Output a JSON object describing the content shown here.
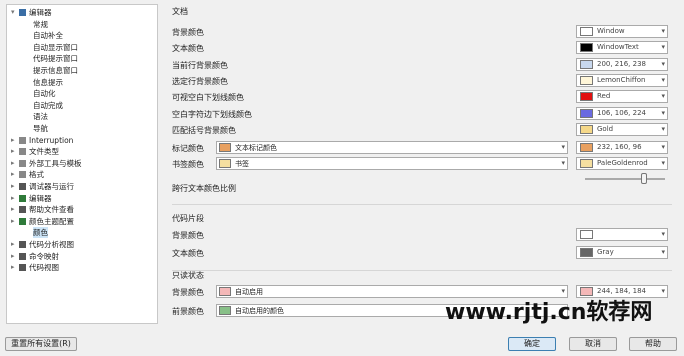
{
  "tree": {
    "items": [
      {
        "label": "编辑器",
        "indent": 0,
        "twisty": "▾",
        "icon": "pencil-icon",
        "color": "#3a6ea5",
        "selected": false
      },
      {
        "label": "常规",
        "indent": 1,
        "twisty": "",
        "icon": "",
        "color": "",
        "selected": false
      },
      {
        "label": "自动补全",
        "indent": 1,
        "twisty": "",
        "icon": "",
        "color": "",
        "selected": false
      },
      {
        "label": "自动显示窗口",
        "indent": 1,
        "twisty": "",
        "icon": "",
        "color": "",
        "selected": false
      },
      {
        "label": "代码提示窗口",
        "indent": 1,
        "twisty": "",
        "icon": "",
        "color": "",
        "selected": false
      },
      {
        "label": "提示信息窗口",
        "indent": 1,
        "twisty": "",
        "icon": "",
        "color": "",
        "selected": false
      },
      {
        "label": "信息提示",
        "indent": 1,
        "twisty": "",
        "icon": "",
        "color": "",
        "selected": false
      },
      {
        "label": "自动化",
        "indent": 1,
        "twisty": "",
        "icon": "",
        "color": "",
        "selected": false
      },
      {
        "label": "自动完成",
        "indent": 1,
        "twisty": "",
        "icon": "",
        "color": "",
        "selected": false
      },
      {
        "label": "语法",
        "indent": 1,
        "twisty": "",
        "icon": "",
        "color": "",
        "selected": false
      },
      {
        "label": "导航",
        "indent": 1,
        "twisty": "",
        "icon": "",
        "color": "",
        "selected": false
      },
      {
        "label": "Interruption",
        "indent": 0,
        "twisty": "▸",
        "icon": "interrupt-icon",
        "color": "#888888",
        "selected": false
      },
      {
        "label": "文件类型",
        "indent": 0,
        "twisty": "▸",
        "icon": "file-type-icon",
        "color": "#888888",
        "selected": false
      },
      {
        "label": "外部工具与模板",
        "indent": 0,
        "twisty": "▸",
        "icon": "tools-icon",
        "color": "#888888",
        "selected": false
      },
      {
        "label": "格式",
        "indent": 0,
        "twisty": "▸",
        "icon": "format-icon",
        "color": "#888888",
        "selected": false
      },
      {
        "label": "调试器与运行",
        "indent": 0,
        "twisty": "▸",
        "icon": "debugger-icon",
        "color": "#555555",
        "selected": false
      },
      {
        "label": "编辑器",
        "indent": 0,
        "twisty": "▸",
        "icon": "editor-icon",
        "color": "#2f7a3a",
        "selected": false
      },
      {
        "label": "帮助文件查看",
        "indent": 0,
        "twisty": "▸",
        "icon": "help-icon",
        "color": "#555555",
        "selected": false
      },
      {
        "label": "颜色主题配置",
        "indent": 0,
        "twisty": "▸",
        "icon": "theme-icon",
        "color": "#2f7a3a",
        "selected": false
      },
      {
        "label": "颜色",
        "indent": 1,
        "twisty": "",
        "icon": "",
        "color": "",
        "selected": true
      },
      {
        "label": "代码分析视图",
        "indent": 0,
        "twisty": "▸",
        "icon": "analysis-icon",
        "color": "#555555",
        "selected": false
      },
      {
        "label": "命令映射",
        "indent": 0,
        "twisty": "▸",
        "icon": "command-icon",
        "color": "#555555",
        "selected": false
      },
      {
        "label": "代码视图",
        "indent": 0,
        "twisty": "▸",
        "icon": "codeview-icon",
        "color": "#555555",
        "selected": false
      }
    ]
  },
  "sections": {
    "tabs": "文档",
    "other": "代码片段",
    "readonly": "只读状态"
  },
  "rows": [
    {
      "label": "背景颜色",
      "swatch": "#ffffff",
      "text": "Window"
    },
    {
      "label": "文本颜色",
      "swatch": "#000000",
      "text": "WindowText"
    },
    {
      "label": "当前行背景颜色",
      "swatch": "#c8d8ee",
      "text": "200, 216, 238"
    },
    {
      "label": "选定行背景颜色",
      "swatch": "#fff6d8",
      "text": "LemonChiffon"
    },
    {
      "label": "可视空白下划线颜色",
      "swatch": "#e01010",
      "text": "Red"
    },
    {
      "label": "空白字符边下划线颜色",
      "swatch": "#6a6ae0",
      "text": "106, 106, 224"
    },
    {
      "label": "匹配括号背景颜色",
      "swatch": "#f5d889",
      "text": "Gold"
    }
  ],
  "wide_rows": [
    {
      "label": "标记颜色",
      "wide_swatch": "#e8a060",
      "wide_text": "文本标记颜色",
      "swatch": "#e8a060",
      "text": "232, 160, 96"
    },
    {
      "label": "书签颜色",
      "wide_swatch": "#f5dfa0",
      "wide_text": "书签",
      "swatch": "#f5dfa0",
      "text": "PaleGoldenrod"
    }
  ],
  "slider_label": "跨行文本颜色比例",
  "other_rows": [
    {
      "label": "背景颜色",
      "swatch": "#ffffff",
      "text": ""
    },
    {
      "label": "文本颜色",
      "swatch": "#666666",
      "text": "Gray"
    }
  ],
  "readonly_rows": [
    {
      "label": "背景颜色",
      "wide_swatch": "#f4b8b8",
      "wide_text": "自动启用",
      "swatch": "#f4b8b8",
      "text": "244, 184, 184"
    },
    {
      "label": "前景颜色",
      "wide_swatch": "#88c088",
      "wide_text": "自动启用的颜色",
      "swatch": "",
      "text": ""
    }
  ],
  "buttons": {
    "restore": "重置所有设置(R)",
    "ok": "确定",
    "cancel": "取消",
    "help": "帮助"
  },
  "watermark": "www.rjtj.cn软荐网"
}
